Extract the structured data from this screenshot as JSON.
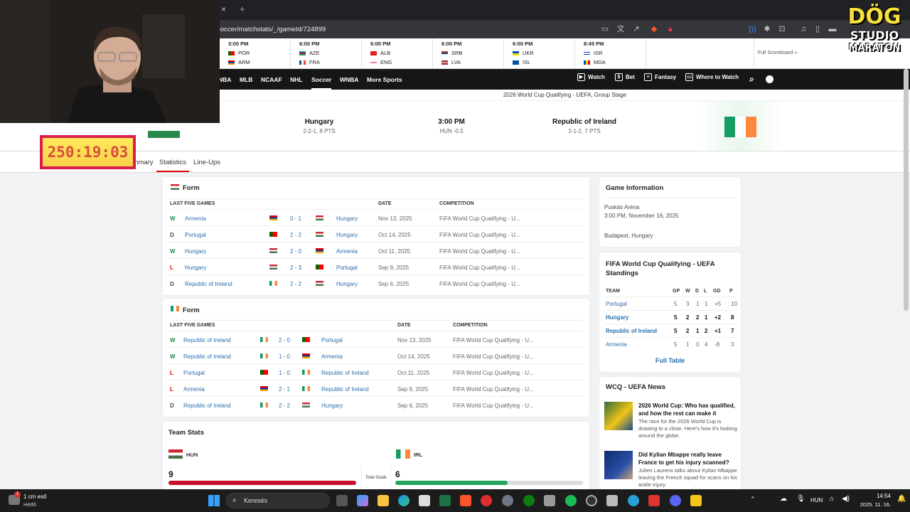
{
  "browser": {
    "url": "soccer/matchstats/_/gameId/724899",
    "tab_close": "×",
    "tab_new": "+"
  },
  "scoreboard": {
    "games": [
      {
        "time": "3:00 PM",
        "team1": "POR",
        "team2": "ARM"
      },
      {
        "time": "6:00 PM",
        "team1": "AZE",
        "team2": "FRA"
      },
      {
        "time": "6:00 PM",
        "team1": "ALB",
        "team2": "ENG"
      },
      {
        "time": "6:00 PM",
        "team1": "SRB",
        "team2": "LVA"
      },
      {
        "time": "6:00 PM",
        "team1": "UKR",
        "team2": "ISL"
      },
      {
        "time": "8:45 PM",
        "team1": "ISR",
        "team2": "MDA"
      }
    ],
    "full_link": "Full Scoreboard »"
  },
  "nav": {
    "items": [
      "NBA",
      "MLB",
      "NCAAF",
      "NHL",
      "Soccer",
      "WNBA",
      "More Sports"
    ],
    "right": [
      "Watch",
      "Bet",
      "Fantasy",
      "Where to Watch"
    ]
  },
  "match": {
    "competition": "2026 World Cup Qualifying - UEFA, Group Stage",
    "home_name": "Hungary",
    "home_record": "2-2-1, 8 PTS",
    "time": "3:00 PM",
    "line": "HUN -0.5",
    "away_name": "Republic of Ireland",
    "away_record": "2-1-2, 7 PTS"
  },
  "tabs": [
    "Summary",
    "Statistics",
    "Line-Ups"
  ],
  "overlay": {
    "timer": "250:19:03",
    "logo1": "DÖG",
    "logo2": "STUDIO",
    "logo3": "MARATON"
  },
  "form_hun": {
    "title": "Form",
    "headers": [
      "LAST FIVE GAMES",
      "DATE",
      "COMPETITION"
    ],
    "rows": [
      {
        "r": "W",
        "t1": "Armenia",
        "s": "0 - 1",
        "t2": "Hungary",
        "d": "Nov 13, 2025",
        "c": "FIFA World Cup Qualifying - U...",
        "f1": "arm",
        "f2": "hun"
      },
      {
        "r": "D",
        "t1": "Portugal",
        "s": "2 - 2",
        "t2": "Hungary",
        "d": "Oct 14, 2025",
        "c": "FIFA World Cup Qualifying - U...",
        "f1": "por",
        "f2": "hun"
      },
      {
        "r": "W",
        "t1": "Hungary",
        "s": "2 - 0",
        "t2": "Armenia",
        "d": "Oct 11, 2025",
        "c": "FIFA World Cup Qualifying - U...",
        "f1": "hun",
        "f2": "arm"
      },
      {
        "r": "L",
        "t1": "Hungary",
        "s": "2 - 3",
        "t2": "Portugal",
        "d": "Sep 9, 2025",
        "c": "FIFA World Cup Qualifying - U...",
        "f1": "hun",
        "f2": "por"
      },
      {
        "r": "D",
        "t1": "Republic of Ireland",
        "s": "2 - 2",
        "t2": "Hungary",
        "d": "Sep 6, 2025",
        "c": "FIFA World Cup Qualifying - U...",
        "f1": "irl",
        "f2": "hun"
      }
    ]
  },
  "form_irl": {
    "title": "Form",
    "headers": [
      "LAST FIVE GAMES",
      "DATE",
      "COMPETITION"
    ],
    "rows": [
      {
        "r": "W",
        "t1": "Republic of Ireland",
        "s": "2 - 0",
        "t2": "Portugal",
        "d": "Nov 13, 2025",
        "c": "FIFA World Cup Qualifying - U...",
        "f1": "irl",
        "f2": "por"
      },
      {
        "r": "W",
        "t1": "Republic of Ireland",
        "s": "1 - 0",
        "t2": "Armenia",
        "d": "Oct 14, 2025",
        "c": "FIFA World Cup Qualifying - U...",
        "f1": "irl",
        "f2": "arm"
      },
      {
        "r": "L",
        "t1": "Portugal",
        "s": "1 - 0",
        "t2": "Republic of Ireland",
        "d": "Oct 11, 2025",
        "c": "FIFA World Cup Qualifying - U...",
        "f1": "por",
        "f2": "irl"
      },
      {
        "r": "L",
        "t1": "Armenia",
        "s": "2 - 1",
        "t2": "Republic of Ireland",
        "d": "Sep 9, 2025",
        "c": "FIFA World Cup Qualifying - U...",
        "f1": "arm",
        "f2": "irl"
      },
      {
        "r": "D",
        "t1": "Republic of Ireland",
        "s": "2 - 2",
        "t2": "Hungary",
        "d": "Sep 6, 2025",
        "c": "FIFA World Cup Qualifying - U...",
        "f1": "irl",
        "f2": "hun"
      }
    ]
  },
  "team_stats": {
    "title": "Team Stats",
    "home": "HUN",
    "away": "IRL",
    "stat_label": "Total Goals",
    "home_value": "9",
    "away_value": "6",
    "home_fraction": 1.0,
    "away_fraction": 0.6
  },
  "game_info": {
    "title": "Game Information",
    "venue": "Puskás Aréna",
    "datetime": "3:00 PM, November 16, 2025",
    "location": "Budapest, Hungary"
  },
  "standings": {
    "title": "FIFA World Cup Qualifying - UEFA Standings",
    "headers": [
      "TEAM",
      "GP",
      "W",
      "D",
      "L",
      "GD",
      "P"
    ],
    "rows": [
      {
        "team": "Portugal",
        "gp": "5",
        "w": "3",
        "d": "1",
        "l": "1",
        "gd": "+5",
        "p": "10",
        "bold": false
      },
      {
        "team": "Hungary",
        "gp": "5",
        "w": "2",
        "d": "2",
        "l": "1",
        "gd": "+2",
        "p": "8",
        "bold": true
      },
      {
        "team": "Republic of Ireland",
        "gp": "5",
        "w": "2",
        "d": "1",
        "l": "2",
        "gd": "+1",
        "p": "7",
        "bold": true
      },
      {
        "team": "Armenia",
        "gp": "5",
        "w": "1",
        "d": "0",
        "l": "4",
        "gd": "-8",
        "p": "3",
        "bold": false
      }
    ],
    "full_table": "Full Table"
  },
  "news": {
    "title": "WCQ - UEFA News",
    "items": [
      {
        "headline": "2026 World Cup: Who has qualified, and how the rest can make it",
        "desc": "The race for the 2026 World Cup is drawing to a close. Here's how it's looking around the globe."
      },
      {
        "headline": "Did Kylian Mbappe really leave France to get his injury scanned?",
        "desc": "Julien Laurens talks about Kylian Mbappe leaving the French squad for scans on his ankle injury."
      }
    ]
  },
  "taskbar": {
    "weather": "1 cm eső",
    "day": "Hétfő",
    "search": "Keresés",
    "lang": "HUN",
    "time": "14:54",
    "date": "2025. 11. 16.",
    "weather_badge": "1"
  },
  "colors": {
    "accent": "#2b6dad",
    "win": "#208c4c",
    "loss": "#dd0000",
    "hun_bar": "#c8102e",
    "irl_bar": "#22a55b"
  }
}
